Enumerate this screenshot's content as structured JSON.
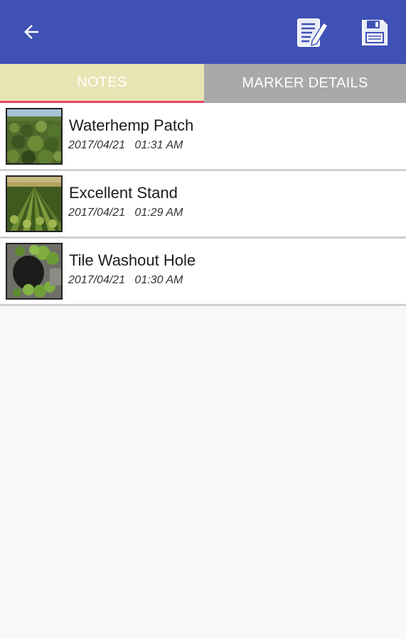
{
  "appbar": {
    "back_icon": "arrow-left-icon",
    "edit_icon": "edit-note-icon",
    "save_icon": "floppy-disk-icon",
    "color": "#3f51b5"
  },
  "tabs": [
    {
      "label": "NOTES",
      "active": true
    },
    {
      "label": "MARKER DETAILS",
      "active": false
    }
  ],
  "notes": [
    {
      "title": "Waterhemp Patch",
      "date": "2017/04/21",
      "time": "01:31 AM",
      "thumb": "field-weeds-photo"
    },
    {
      "title": "Excellent Stand",
      "date": "2017/04/21",
      "time": "01:29 AM",
      "thumb": "crop-rows-photo"
    },
    {
      "title": "Tile Washout Hole",
      "date": "2017/04/21",
      "time": "01:30 AM",
      "thumb": "washout-hole-photo"
    }
  ]
}
